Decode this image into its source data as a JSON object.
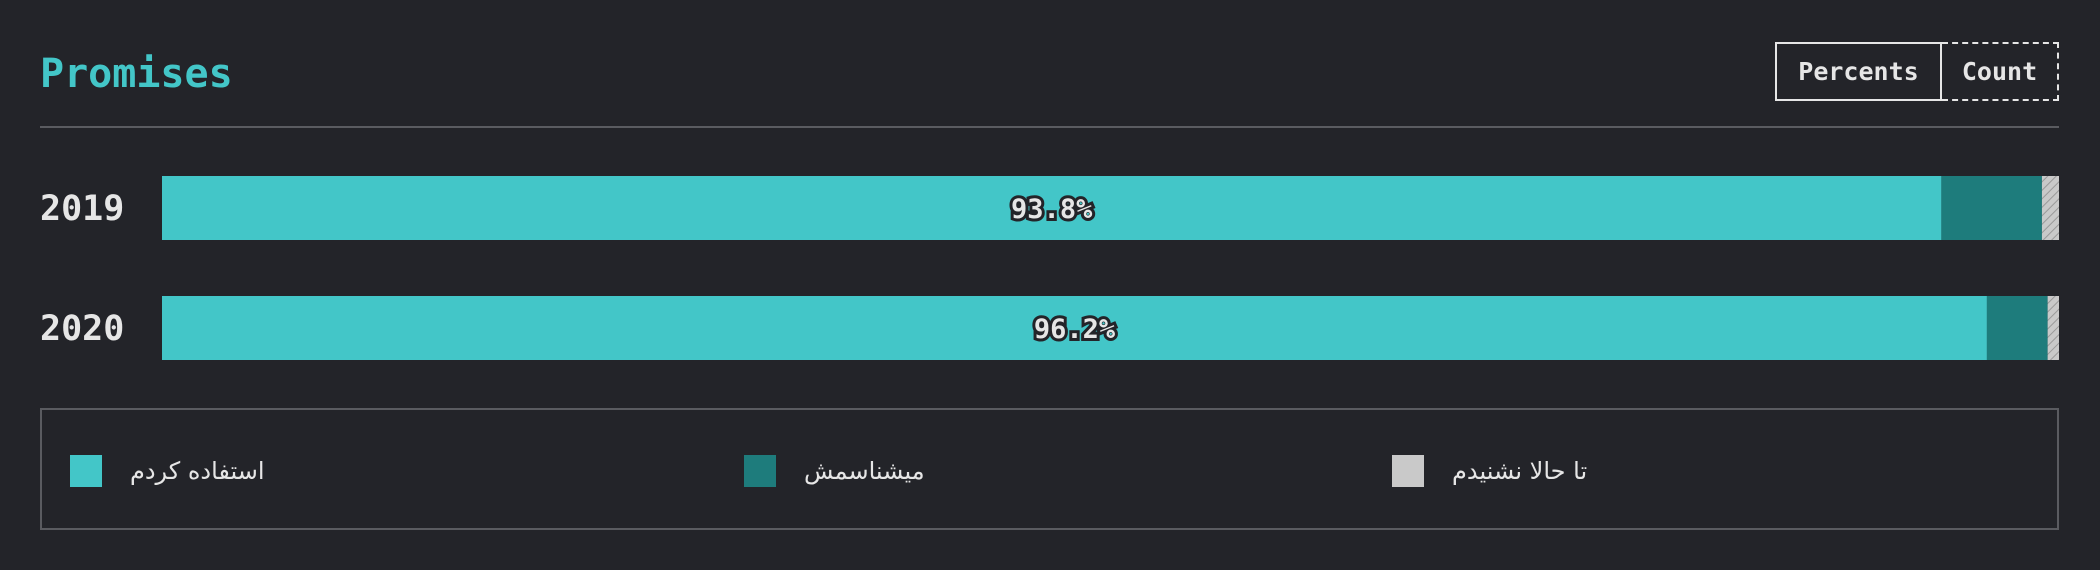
{
  "header": {
    "title": "Promises",
    "toggle": {
      "percents_label": "Percents",
      "count_label": "Count",
      "active": "Percents"
    }
  },
  "colors": {
    "used": "#43c6c8",
    "know": "#1e7c7c",
    "never": "#c9c9c9",
    "background": "#232429"
  },
  "chart_data": {
    "type": "bar",
    "orientation": "horizontal",
    "stacked": true,
    "categories": [
      "2019",
      "2020"
    ],
    "series": [
      {
        "name": "استفاده کردم",
        "values": [
          93.8,
          96.2
        ]
      },
      {
        "name": "میشناسمش",
        "values": [
          5.3,
          3.2
        ]
      },
      {
        "name": "تا حالا نشنیدم",
        "values": [
          0.9,
          0.6
        ]
      }
    ],
    "data_labels": [
      "93.8%",
      "96.2%"
    ],
    "xlim": [
      0,
      100
    ],
    "legend_position": "bottom"
  },
  "legend": {
    "items": [
      {
        "label": "استفاده کردم",
        "color": "#43c6c8"
      },
      {
        "label": "میشناسمش",
        "color": "#1e7c7c"
      },
      {
        "label": "تا حالا نشنیدم",
        "color": "#c9c9c9"
      }
    ]
  }
}
